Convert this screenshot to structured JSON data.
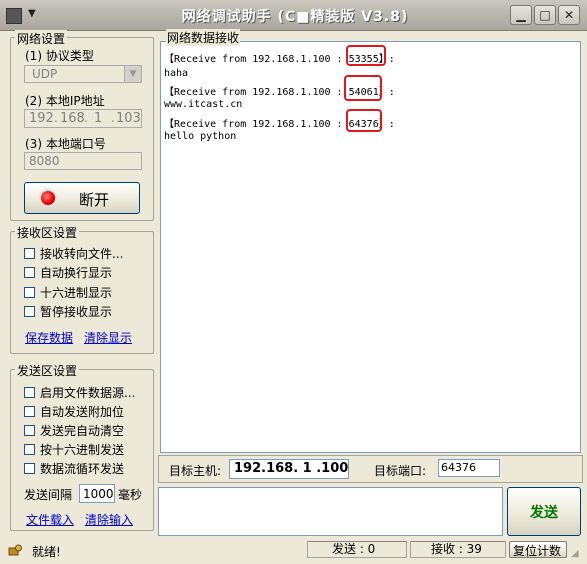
{
  "window": {
    "title": "网络调试助手 (C■精装版 V3.8)"
  },
  "network": {
    "group_label": "网络设置",
    "protocol_label": "(1) 协议类型",
    "protocol_value": "UDP",
    "ip_label": "(2) 本地IP地址",
    "ip_parts": [
      "192",
      "168",
      "1",
      "103"
    ],
    "port_label": "(3) 本地端口号",
    "port_value": "8080",
    "disconnect_label": "断开"
  },
  "recv_settings": {
    "group_label": "接收区设置",
    "options": [
      "接收转向文件...",
      "自动换行显示",
      "十六进制显示",
      "暂停接收显示"
    ],
    "save_link": "保存数据",
    "clear_link": "清除显示"
  },
  "send_settings": {
    "group_label": "发送区设置",
    "options": [
      "启用文件数据源...",
      "自动发送附加位",
      "发送完自动清空",
      "按十六进制发送",
      "数据流循环发送"
    ],
    "interval_label": "发送间隔",
    "interval_value": "1000",
    "interval_unit": "毫秒",
    "load_link": "文件载入",
    "clear_link": "清除输入"
  },
  "receive": {
    "group_label": "网络数据接收",
    "lines": [
      {
        "prefix": "【Receive from 192.168.1.100 : ",
        "port": "53355",
        "suffix": "】:"
      },
      {
        "text": "haha"
      },
      {
        "prefix": "【Receive from 192.168.1.100 : ",
        "port": "54061",
        "suffix": "】:"
      },
      {
        "text": "www.itcast.cn"
      },
      {
        "prefix": "【Receive from 192.168.1.100 : ",
        "port": "64376",
        "suffix": "】:"
      },
      {
        "text": "hello python"
      }
    ]
  },
  "target": {
    "host_label": "目标主机:",
    "host_value": "192.168. 1 .100",
    "port_label": "目标端口:",
    "port_value": "64376"
  },
  "send": {
    "input_value": "",
    "button_label": "发送"
  },
  "status": {
    "ready_text": "就绪!",
    "sent_label": "发送 : 0",
    "recv_label": "接收 : 39",
    "reset_label": "复位计数"
  }
}
